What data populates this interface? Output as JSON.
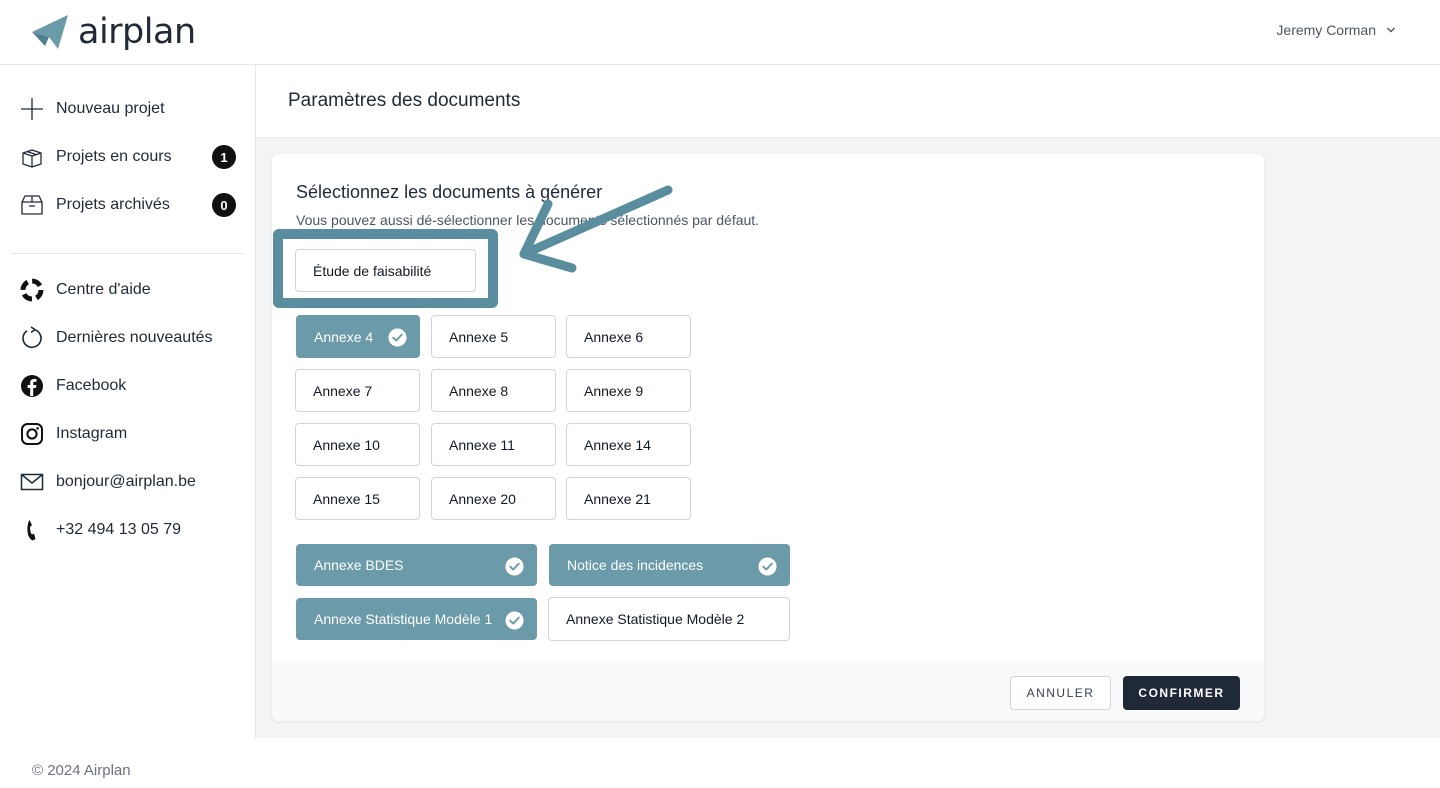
{
  "app": {
    "logo_text": "airplan",
    "user_name": "Jeremy Corman"
  },
  "sidebar": {
    "items": [
      {
        "label": "Nouveau projet",
        "icon": "plus-icon"
      },
      {
        "label": "Projets en cours",
        "icon": "box-open-icon",
        "badge": "1"
      },
      {
        "label": "Projets archivés",
        "icon": "archive-box-icon",
        "badge": "0"
      },
      {
        "label": "Centre d'aide",
        "icon": "lifebuoy-icon"
      },
      {
        "label": "Dernières nouveautés",
        "icon": "refresh-icon"
      },
      {
        "label": "Facebook",
        "icon": "facebook-icon"
      },
      {
        "label": "Instagram",
        "icon": "instagram-icon"
      },
      {
        "label": "bonjour@airplan.be",
        "icon": "mail-icon"
      },
      {
        "label": "+32 494 13 05 79",
        "icon": "phone-icon"
      }
    ]
  },
  "main": {
    "page_title": "Paramètres des documents",
    "card_title": "Sélectionnez les documents à générer",
    "card_subtitle": "Vous pouvez aussi dé-sélectionner les documents sélectionnés par défaut.",
    "featured_doc": {
      "label": "Étude de faisabilité",
      "selected": false
    },
    "annex_grid": [
      {
        "label": "Annexe 4",
        "selected": true
      },
      {
        "label": "Annexe 5",
        "selected": false
      },
      {
        "label": "Annexe 6",
        "selected": false
      },
      {
        "label": "Annexe 7",
        "selected": false
      },
      {
        "label": "Annexe 8",
        "selected": false
      },
      {
        "label": "Annexe 9",
        "selected": false
      },
      {
        "label": "Annexe 10",
        "selected": false
      },
      {
        "label": "Annexe 11",
        "selected": false
      },
      {
        "label": "Annexe 14",
        "selected": false
      },
      {
        "label": "Annexe 15",
        "selected": false
      },
      {
        "label": "Annexe 20",
        "selected": false
      },
      {
        "label": "Annexe 21",
        "selected": false
      }
    ],
    "wide_docs": [
      {
        "label": "Annexe BDES",
        "selected": true
      },
      {
        "label": "Notice des incidences",
        "selected": true
      },
      {
        "label": "Annexe Statistique Modèle 1",
        "selected": true
      },
      {
        "label": "Annexe Statistique Modèle 2",
        "selected": false
      }
    ],
    "cancel_label": "ANNULER",
    "confirm_label": "CONFIRMER"
  },
  "footer": {
    "copyright": "© 2024 Airplan"
  },
  "colors": {
    "accent": "#6b9aa9",
    "highlight": "#5a8e9e",
    "dark": "#1f2937"
  }
}
